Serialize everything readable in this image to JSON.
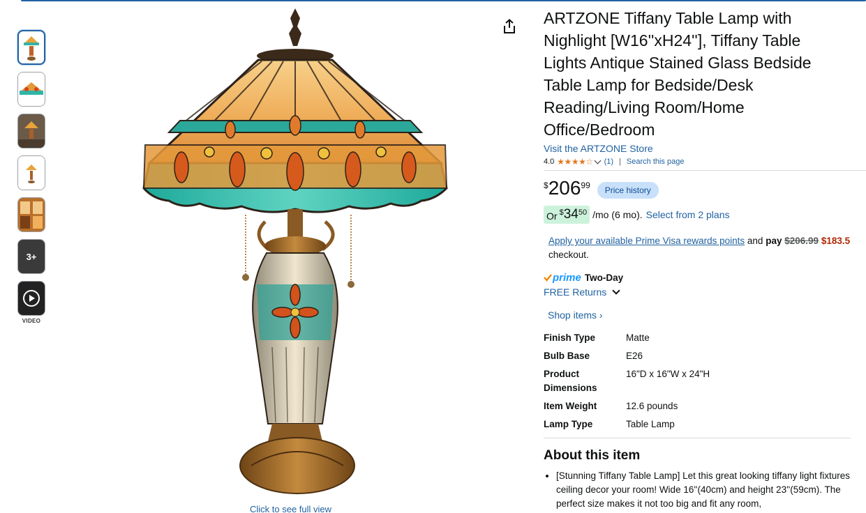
{
  "product": {
    "title": "ARTZONE Tiffany Table Lamp with Nighlight [W16''xH24''], Tiffany Table Lights Antique Stained Glass Bedside Table Lamp for Bedside/Desk Reading/Living Room/Home Office/Bedroom",
    "store_link": "Visit the ARTZONE Store",
    "rating": "4.0",
    "stars": "★★★★☆",
    "rating_count": "(1)",
    "separator": "|",
    "search_page": "Search this page"
  },
  "price": {
    "symbol": "$",
    "whole": "206",
    "fraction": "99",
    "history_button": "Price history"
  },
  "monthly": {
    "or": "Or",
    "symbol": "$",
    "whole": "34",
    "fraction": "50",
    "per": "/mo (6 mo).",
    "select": "Select from 2 plans"
  },
  "visa": {
    "link": "Apply your available Prime Visa rewards points",
    "and": "and",
    "pay": "pay",
    "old_price": "$206.99",
    "new_price": "$183.5",
    "checkout": "checkout."
  },
  "delivery": {
    "prime": "prime",
    "two_day": "Two-Day",
    "returns": "FREE Returns"
  },
  "shop_items": "Shop items ›",
  "specs": [
    {
      "key": "Finish Type",
      "value": "Matte"
    },
    {
      "key": "Bulb Base",
      "value": "E26"
    },
    {
      "key": "Product Dimensions",
      "value": "16\"D x 16\"W x 24\"H"
    },
    {
      "key": "Item Weight",
      "value": "12.6 pounds"
    },
    {
      "key": "Lamp Type",
      "value": "Table Lamp"
    }
  ],
  "about": {
    "heading": "About this item",
    "bullets": [
      "[Stunning Tiffany Table Lamp] Let this great looking tiffany light fixtures ceiling decor your room! Wide 16''(40cm) and height 23''(59cm). The perfect size makes it not too big and fit any room,"
    ]
  },
  "gallery": {
    "more_label": "3+",
    "video_label": "VIDEO",
    "click_full": "Click to see full view"
  },
  "colors": {
    "link": "#2162a1",
    "price_history_bg": "#c8e0fa",
    "monthly_bg": "#cdf2dc",
    "sale_red": "#b12704",
    "prime_blue": "#1a98ff",
    "star": "#de7921"
  }
}
